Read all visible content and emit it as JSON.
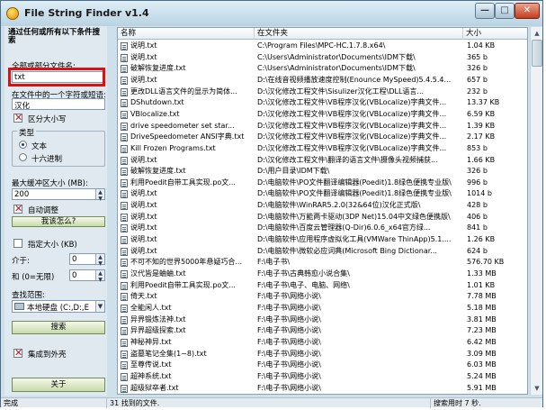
{
  "window": {
    "title": "File String Finder v1.4",
    "buttons": {
      "minimize": "—",
      "maximize": "□",
      "close": "✕"
    }
  },
  "left": {
    "heading": "通过任何或所有以下条件搜索",
    "filename_label": "全部或部分文件名:",
    "filename_value": "txt",
    "content_label": "在文件中的一个字符或短语:",
    "content_value": "汉化",
    "case_label": "区分大小写",
    "type_label": "类型",
    "type_text": "文本",
    "type_hex": "十六进制",
    "buffer_label": "最大缓冲区大小 (MB):",
    "buffer_value": "200",
    "auto_adjust_label": "自动调整",
    "adjust_button": "我该怎么?",
    "size_label": "指定大小 (KB)",
    "between_label": "介于:",
    "between_value": "0",
    "and_label": "和 (0=无限)",
    "and_value": "0",
    "scope_label": "查找范围:",
    "scope_value": "本地硬盘 (C:,D:,E",
    "search_button": "搜索",
    "integrate_label": "集成到外壳",
    "close_button": "关于"
  },
  "list": {
    "columns": [
      "名称",
      "在文件夹",
      "大小"
    ],
    "rows": [
      [
        "说明.txt",
        "C:\\Program Files\\MPC-HC.1.7.8.x64\\",
        "1.04 KB"
      ],
      [
        "说明.txt",
        "C:\\Users\\Administrator\\Documents\\IDM下载\\",
        "365 b"
      ],
      [
        "破解恢复进度.txt",
        "C:\\Users\\Administrator\\Documents\\IDM下载\\",
        "326 b"
      ],
      [
        "说明.txt",
        "D:\\在线音视频播放速度控制(Enounce MySpeed)5.4.5.4...",
        "657 b"
      ],
      [
        "更改DLL语言文件的显示为简体...",
        "D:\\汉化修改工程文件\\Sisulizer汉化工程\\DLL语言...",
        "232 b"
      ],
      [
        "DShutdown.txt",
        "D:\\汉化修改工程文件\\VB程序汉化(VBLocalize)字典文件...",
        "13.37 KB"
      ],
      [
        "VBlocalize.txt",
        "D:\\汉化修改工程文件\\VB程序汉化(VBLocalize)字典文件...",
        "6.59 KB"
      ],
      [
        "drive speedometer set star...",
        "D:\\汉化修改工程文件\\VB程序汉化(VBLocalize)字典文件...",
        "1.39 KB"
      ],
      [
        "DriveSpeedometer ANSI字典.txt",
        "D:\\汉化修改工程文件\\VB程序汉化(VBLocalize)字典文件...",
        "2.17 KB"
      ],
      [
        "Kill Frozen Programs.txt",
        "D:\\汉化修改工程文件\\VB程序汉化(VBLocalize)字典文件...",
        "853 b"
      ],
      [
        "说明.txt",
        "D:\\汉化修改工程文件\\翻译的语言文件\\摄像头视频捕获...",
        "1.66 KB"
      ],
      [
        "破解恢复进度.txt",
        "D:\\用户目录\\IDM下载\\",
        "326 b"
      ],
      [
        "利用Poedit自带工具实现.po文...",
        "D:\\电脑软件\\PO文件翻译编辑器(Poedit)1.8绿色便携专业版\\",
        "996 b"
      ],
      [
        "说明.txt",
        "D:\\电脑软件\\PO文件翻译编辑器(Poedit)1.8绿色便携专业版\\",
        "1014 b"
      ],
      [
        "说明.txt",
        "D:\\电脑软件\\WinRAR5.2.0(32&64位)汉化正式版\\",
        "428 b"
      ],
      [
        "说明.txt",
        "D:\\电脑软件\\万能两卡驱动(3DP Net)15.04中文绿色便携版\\",
        "406 b"
      ],
      [
        "说明.txt",
        "D:\\电脑软件\\百度云管理器(Q-Dir)6.0.6_x64官方绿...",
        "841 b"
      ],
      [
        "说明.txt",
        "D:\\电脑软件\\应用程序虚拟化工具(VMWare ThinApp)5.1....",
        "1.26 KB"
      ],
      [
        "说明.txt",
        "D:\\电脑软件\\微软必应词典(Microsoft Bing Dictionar...",
        "624 b"
      ],
      [
        "不可不知的世界5000年悬疑巧合...",
        "F:\\电子书\\",
        "576.70 KB"
      ],
      [
        "汉代皆是蛐蛐.txt",
        "F:\\电子书\\古典韩愈小说合集\\",
        "1.33 MB"
      ],
      [
        "利用Poedit自带工具实现.po文...",
        "F:\\电子书\\电子、电脑、网络\\",
        "1.01 KB"
      ],
      [
        "倚天.txt",
        "F:\\电子书\\网络小说\\",
        "7.78 MB"
      ],
      [
        "全能闲人.txt",
        "F:\\电子书\\网络小说\\",
        "5.18 MB"
      ],
      [
        "异界锻炼法神.txt",
        "F:\\电子书\\网络小说\\",
        "3.81 MB"
      ],
      [
        "异界超级探索.txt",
        "F:\\电子书\\网络小说\\",
        "7.23 MB"
      ],
      [
        "神秘神异.txt",
        "F:\\电子书\\网络小说\\",
        "6.42 MB"
      ],
      [
        "盗墓笔记全集(1~8).txt",
        "F:\\电子书\\网络小说\\",
        "3.09 MB"
      ],
      [
        "至尊传说.txt",
        "F:\\电子书\\网络小说\\",
        "6.03 MB"
      ],
      [
        "超神系统.txt",
        "F:\\电子书\\网络小说\\",
        "5.24 MB"
      ],
      [
        "超级狱卒者.txt",
        "F:\\电子书\\网络小说\\",
        "5.91 MB"
      ]
    ]
  },
  "status": {
    "state": "完成",
    "found": "31 找到的文件.",
    "time": "搜索用时 7 秒."
  },
  "colors": {
    "highlight_box": "#e01010",
    "panel_bg": "#dfe9ef"
  }
}
